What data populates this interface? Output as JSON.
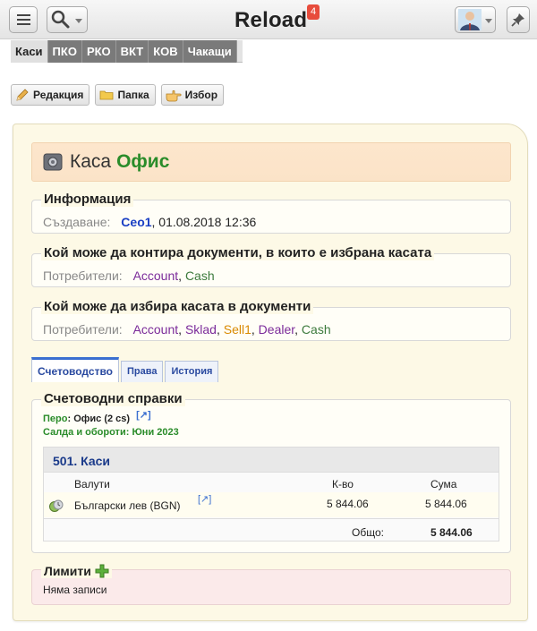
{
  "header": {
    "brand": "Reload",
    "notifications_count": "4"
  },
  "nav_tabs": [
    {
      "label": "Каси",
      "active": true
    },
    {
      "label": "ПКО",
      "active": false
    },
    {
      "label": "РКО",
      "active": false
    },
    {
      "label": "ВКТ",
      "active": false
    },
    {
      "label": "КОВ",
      "active": false
    },
    {
      "label": "Чакащи",
      "active": false
    }
  ],
  "toolbar": {
    "edit_label": "Редакция",
    "folder_label": "Папка",
    "select_label": "Избор"
  },
  "page": {
    "title_prefix": "Каса",
    "title_name": "Офис"
  },
  "info": {
    "legend": "Информация",
    "created_label": "Създаване:",
    "created_user": "Ceo1",
    "created_date": ", 01.08.2018 12:36"
  },
  "post_rights": {
    "legend": "Кой може да контира документи, в които е избрана касата",
    "users_label": "Потребители:",
    "users": [
      {
        "name": "Account",
        "color": "#7b2b9a"
      },
      {
        "name": "Cash",
        "color": "#3c7a3c"
      }
    ]
  },
  "select_rights": {
    "legend": "Кой може да избира касата в документи",
    "users_label": "Потребители:",
    "users": [
      {
        "name": "Account",
        "color": "#7b2b9a"
      },
      {
        "name": "Sklad",
        "color": "#7b2b9a"
      },
      {
        "name": "Sell1",
        "color": "#d98a00"
      },
      {
        "name": "Dealer",
        "color": "#7b2b9a"
      },
      {
        "name": "Cash",
        "color": "#3c7a3c"
      }
    ]
  },
  "sub_tabs": {
    "accounting": "Счетоводство",
    "rights": "Права",
    "history": "История"
  },
  "accounting": {
    "legend": "Счетоводни справки",
    "pero_label": "Перо",
    "pero_value": "Офис (2 cs)",
    "balances_label": "Салда и обороти",
    "balances_value": "Юни 2023",
    "account_title": "501. Каси",
    "col_currency": "Валути",
    "col_qty": "К-во",
    "col_amount": "Сума",
    "row_currency": "Български лев (BGN)",
    "row_qty": "5 844.06",
    "row_amount": "5 844.06",
    "total_label": "Общо:",
    "total_value": "5 844.06"
  },
  "limits": {
    "legend": "Лимити",
    "empty_text": "Няма записи"
  }
}
